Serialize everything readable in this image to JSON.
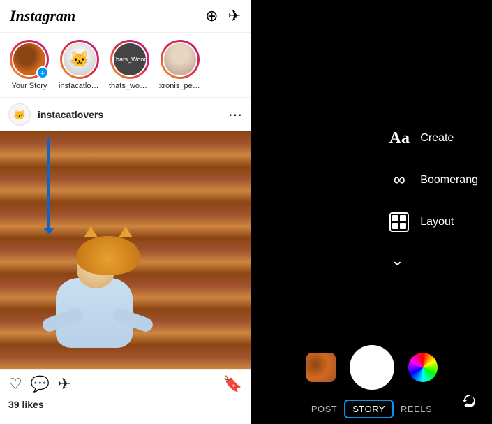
{
  "app": {
    "logo": "Instagram"
  },
  "header": {
    "add_icon": "⊕",
    "send_icon": "✈"
  },
  "stories": [
    {
      "id": "your-story",
      "label": "Your Story",
      "type": "yours"
    },
    {
      "id": "instacatlovers",
      "label": "instacatlovers...",
      "type": "ring"
    },
    {
      "id": "thats_wood",
      "label": "thats_wood_",
      "type": "ring"
    },
    {
      "id": "xronis_pegk",
      "label": "xronis_pegk_...",
      "type": "ring"
    }
  ],
  "post": {
    "username": "instacatlovers____",
    "likes": "39 likes"
  },
  "camera": {
    "options": [
      {
        "id": "create",
        "icon": "Aa",
        "label": "Create"
      },
      {
        "id": "boomerang",
        "icon": "∞",
        "label": "Boomerang"
      },
      {
        "id": "layout",
        "icon": "layout",
        "label": "Layout"
      }
    ],
    "chevron": "⌄",
    "modes": [
      {
        "id": "post",
        "label": "POST",
        "active": false
      },
      {
        "id": "story",
        "label": "STORY",
        "active": true
      },
      {
        "id": "reels",
        "label": "REELS",
        "active": false
      }
    ]
  }
}
